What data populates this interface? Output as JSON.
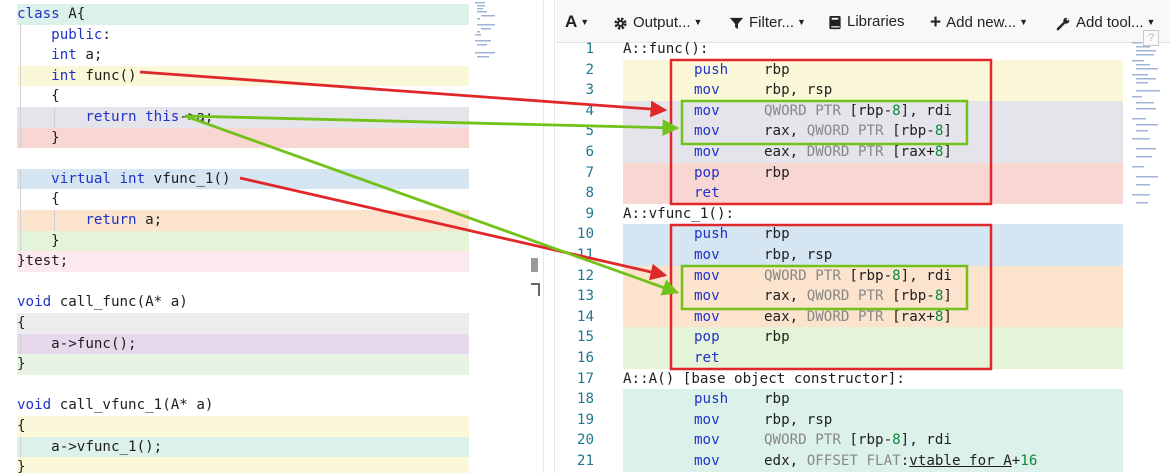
{
  "toolbar": {
    "lang_label": "A",
    "output_label": "Output...",
    "filter_label": "Filter...",
    "libraries_label": "Libraries",
    "add_new_label": "Add new...",
    "add_tool_label": "Add tool..."
  },
  "help_label": "?",
  "colors": {
    "keyword": "#1f33c9",
    "line_number": "#237893",
    "red_arrow": "#e0282a",
    "green_arrow": "#73c21a"
  },
  "source_lines": [
    {
      "code": "class A{",
      "bg": "#dcf1ea"
    },
    {
      "code": "    public:",
      "bg": "#ffffff"
    },
    {
      "code": "    int a;",
      "bg": "#ffffff"
    },
    {
      "code": "    int func()",
      "bg": "#fbf8d9"
    },
    {
      "code": "    {",
      "bg": "#ffffff"
    },
    {
      "code": "        return this->a;",
      "bg": "#e5e4ea"
    },
    {
      "code": "    }",
      "bg": "#f8d6d2"
    },
    {
      "code": "",
      "bg": "#ffffff"
    },
    {
      "code": "    virtual int vfunc_1()",
      "bg": "#d5e5f2"
    },
    {
      "code": "    {",
      "bg": "#ffffff"
    },
    {
      "code": "        return a;",
      "bg": "#fbe3cd"
    },
    {
      "code": "    }",
      "bg": "#e5f3d8"
    },
    {
      "code": "}test;",
      "bg": "#fbe9ee"
    },
    {
      "code": "",
      "bg": "#ffffff"
    },
    {
      "code": "void call_func(A* a)",
      "bg": "#ffffff"
    },
    {
      "code": "{",
      "bg": "#ececec"
    },
    {
      "code": "    a->func();",
      "bg": "#e6d9eb"
    },
    {
      "code": "}",
      "bg": "#e7f4e3"
    },
    {
      "code": "",
      "bg": "#ffffff"
    },
    {
      "code": "void call_vfunc_1(A* a)",
      "bg": "#ffffff"
    },
    {
      "code": "{",
      "bg": "#fbf8d9"
    },
    {
      "code": "    a->vfunc_1();",
      "bg": "#dcf1ea"
    },
    {
      "code": "}",
      "bg": "#fbf8d9"
    }
  ],
  "asm_lines": [
    {
      "n": "1",
      "label": "A::func():"
    },
    {
      "n": "2",
      "op": "push",
      "args": "rbp",
      "bg": "#fbf8d9"
    },
    {
      "n": "3",
      "op": "mov",
      "args": "rbp, rsp",
      "bg": "#fbf8d9"
    },
    {
      "n": "4",
      "op": "mov",
      "args": "QWORD PTR [rbp-8], rdi",
      "bg": "#e5e4ea"
    },
    {
      "n": "5",
      "op": "mov",
      "args": "rax, QWORD PTR [rbp-8]",
      "bg": "#e5e4ea"
    },
    {
      "n": "6",
      "op": "mov",
      "args": "eax, DWORD PTR [rax+8]",
      "bg": "#e5e4ea"
    },
    {
      "n": "7",
      "op": "pop",
      "args": "rbp",
      "bg": "#f8d6d2"
    },
    {
      "n": "8",
      "op": "ret",
      "args": "",
      "bg": "#f8d6d2"
    },
    {
      "n": "9",
      "label": "A::vfunc_1():"
    },
    {
      "n": "10",
      "op": "push",
      "args": "rbp",
      "bg": "#d5e5f2"
    },
    {
      "n": "11",
      "op": "mov",
      "args": "rbp, rsp",
      "bg": "#d5e5f2"
    },
    {
      "n": "12",
      "op": "mov",
      "args": "QWORD PTR [rbp-8], rdi",
      "bg": "#fbe3cd"
    },
    {
      "n": "13",
      "op": "mov",
      "args": "rax, QWORD PTR [rbp-8]",
      "bg": "#fbe3cd"
    },
    {
      "n": "14",
      "op": "mov",
      "args": "eax, DWORD PTR [rax+8]",
      "bg": "#fbe3cd"
    },
    {
      "n": "15",
      "op": "pop",
      "args": "rbp",
      "bg": "#e5f3d8"
    },
    {
      "n": "16",
      "op": "ret",
      "args": "",
      "bg": "#e5f3d8"
    },
    {
      "n": "17",
      "label": "A::A() [base object constructor]:"
    },
    {
      "n": "18",
      "op": "push",
      "args": "rbp",
      "bg": "#dcf1ea"
    },
    {
      "n": "19",
      "op": "mov",
      "args": "rbp, rsp",
      "bg": "#dcf1ea"
    },
    {
      "n": "20",
      "op": "mov",
      "args": "QWORD PTR [rbp-8], rdi",
      "bg": "#dcf1ea"
    },
    {
      "n": "21",
      "op": "mov",
      "args": "edx, OFFSET FLAT:vtable for A+16",
      "bg": "#dcf1ea"
    }
  ]
}
